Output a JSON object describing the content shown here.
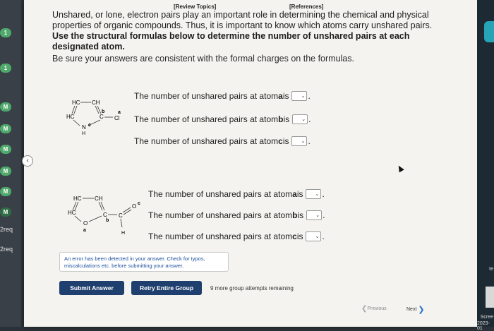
{
  "top_links": {
    "review": "[Review Topics]",
    "references": "[References]"
  },
  "intro": {
    "line1": "Unshared, or lone, electron pairs play an important role in determining the chemical and physical properties of organic compounds. Thus, it is important to know which atoms carry unshared pairs.",
    "bold": "Use the structural formulas below to determine the number of unshared pairs at each designated atom.",
    "note": "Be sure your answers are consistent with the formal charges on the formulas."
  },
  "molecule1": {
    "hc_top_left": "HC",
    "ch_top_right": "CH",
    "hc_left": "HC",
    "c_right": "C",
    "n": "N",
    "h": "H",
    "cl": "Cl",
    "label_a": "a",
    "label_b": "b",
    "label_c": "c"
  },
  "molecule2": {
    "hc_top_left": "HC",
    "ch_top_right": "CH",
    "hc_left": "HC",
    "o_ring": "O",
    "c_ring": "C",
    "c_chain": "C",
    "o_double": "O",
    "h": "H",
    "label_a": "a",
    "label_b": "b",
    "label_c": "c"
  },
  "questions1": [
    {
      "text": "The number of unshared pairs at atom ",
      "atom": "a",
      "suffix": " is"
    },
    {
      "text": "The number of unshared pairs at atom ",
      "atom": "b",
      "suffix": " is"
    },
    {
      "text": "The number of unshared pairs at atom ",
      "atom": "c",
      "suffix": " is"
    }
  ],
  "questions2": [
    {
      "text": "The number of unshared pairs at atom ",
      "atom": "a",
      "suffix": " is"
    },
    {
      "text": "The number of unshared pairs at atom ",
      "atom": "b",
      "suffix": " is"
    },
    {
      "text": "The number of unshared pairs at atom ",
      "atom": "c",
      "suffix": " is"
    }
  ],
  "dropdown_arrow": "⌄",
  "error_message": "An error has been detected in your answer. Check for typos, miscalculations etc. before submitting your answer.",
  "buttons": {
    "submit": "Submit Answer",
    "retry": "Retry Entire Group"
  },
  "attempts": "9 more group attempts remaining",
  "nav": {
    "previous": "Previous",
    "next": "Next"
  },
  "left_badges": [
    "1",
    "1",
    "M",
    "M",
    "M",
    "M",
    "M",
    "M"
  ],
  "left_req": [
    "2req",
    "2req"
  ],
  "right_text": [
    "te",
    "Scree",
    "2023-01"
  ]
}
